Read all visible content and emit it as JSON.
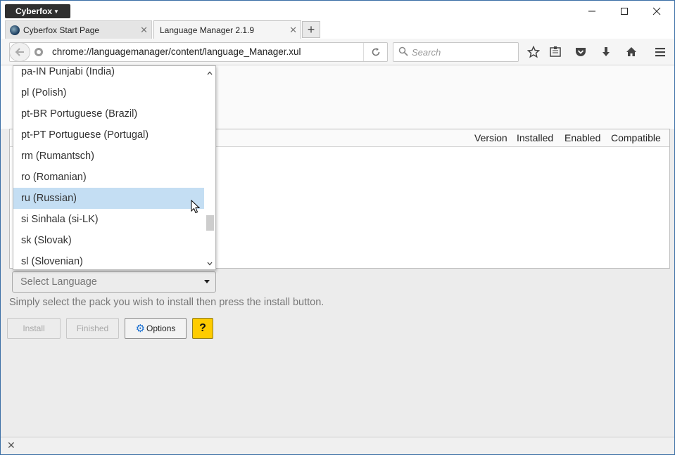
{
  "app_menu": {
    "label": "Cyberfox",
    "icon": "caret-down-icon"
  },
  "window_controls": {
    "minimize": "minimize-icon",
    "maximize": "maximize-icon",
    "close": "close-icon"
  },
  "tabs": [
    {
      "label": "Cyberfox Start Page",
      "active": false
    },
    {
      "label": "Language Manager 2.1.9",
      "active": true
    }
  ],
  "navbar": {
    "url": "chrome://languagemanager/content/language_Manager.xul",
    "search_placeholder": "Search"
  },
  "list": {
    "columns": [
      "Version",
      "Installed",
      "Enabled",
      "Compatible"
    ]
  },
  "language_select": {
    "label": "Select Language",
    "options": [
      "pa-IN Punjabi (India)",
      "pl (Polish)",
      "pt-BR Portuguese (Brazil)",
      "pt-PT Portuguese (Portugal)",
      "rm (Rumantsch)",
      "ro (Romanian)",
      "ru (Russian)",
      "si Sinhala (si-LK)",
      "sk (Slovak)",
      "sl (Slovenian)"
    ],
    "highlighted": "ru (Russian)"
  },
  "hint": "Simply select the pack you wish to install then press the install button.",
  "buttons": {
    "install": "Install",
    "finished": "Finished",
    "options": "Options",
    "help": "?"
  },
  "colors": {
    "highlight": "#c4def3",
    "help_button": "#ffcc00",
    "gear": "#1a6fd0"
  }
}
